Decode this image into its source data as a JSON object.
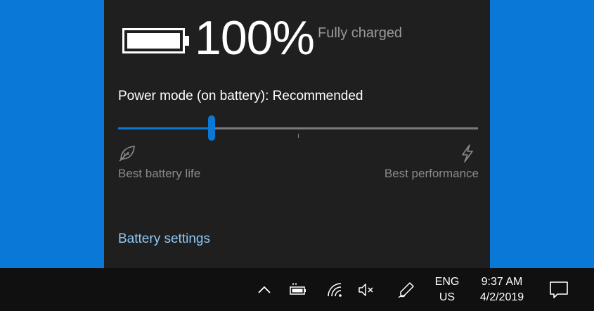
{
  "battery": {
    "percent_label": "100%",
    "status": "Fully charged",
    "level": 1.0
  },
  "power_mode": {
    "label": "Power mode (on battery): Recommended",
    "slider_value": 0.26,
    "tick_positions": [
      0.5
    ],
    "min_label": "Best battery life",
    "max_label": "Best performance",
    "min_icon": "leaf-icon",
    "max_icon": "lightning-bolt-icon"
  },
  "settings_link": "Battery settings",
  "taskbar": {
    "tray_icons": [
      "chevron-up-icon",
      "battery-tray-icon",
      "wifi-icon",
      "volume-muted-icon",
      "pen-icon"
    ],
    "lang_line1": "ENG",
    "lang_line2": "US",
    "time": "9:37 AM",
    "date": "4/2/2019",
    "notification_icon": "action-center-icon"
  },
  "colors": {
    "desktop": "#0a78d7",
    "flyout": "#1f1f1f",
    "taskbar": "#101010",
    "accent": "#0a78d7",
    "link": "#8ec7f4"
  }
}
